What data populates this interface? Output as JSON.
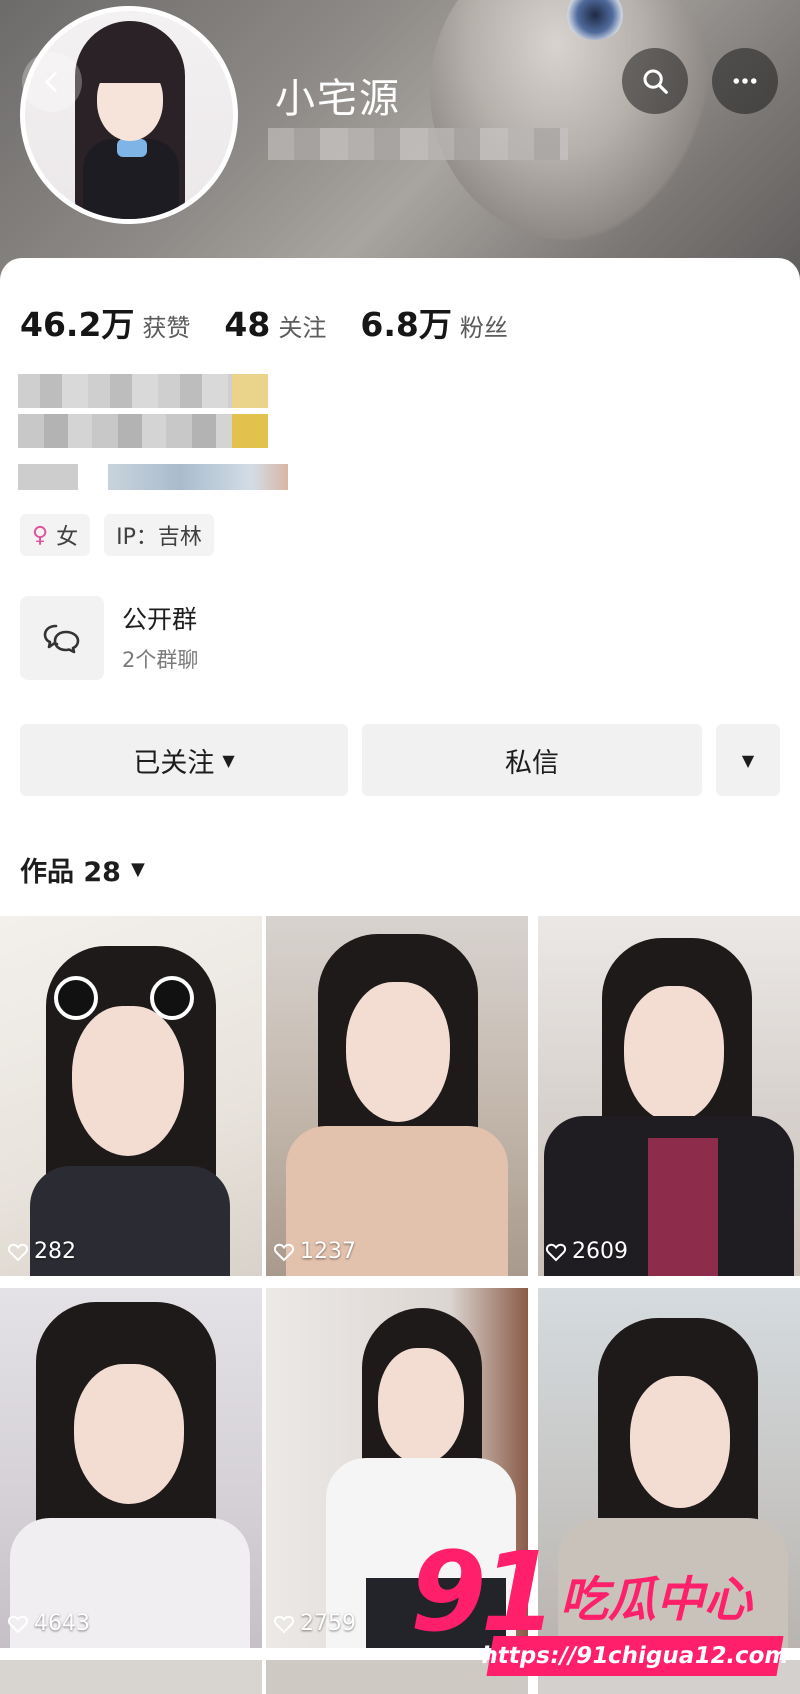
{
  "header": {
    "profile_name": "小宅源"
  },
  "stats": [
    {
      "value": "46.2万",
      "label": "获赞"
    },
    {
      "value": "48",
      "label": "关注"
    },
    {
      "value": "6.8万",
      "label": "粉丝"
    }
  ],
  "tags": {
    "gender": "女",
    "ip": "IP：吉林"
  },
  "group": {
    "title": "公开群",
    "subtitle": "2个群聊"
  },
  "buttons": {
    "follow": "已关注",
    "message": "私信"
  },
  "works": {
    "label": "作品 28"
  },
  "videos": [
    {
      "likes": "282"
    },
    {
      "likes": "1237"
    },
    {
      "likes": "2609"
    },
    {
      "likes": "4643"
    },
    {
      "likes": "2759"
    },
    {
      "likes": ""
    }
  ],
  "watermark": {
    "number": "91",
    "name": "吃瓜中心",
    "url": "https://91chigua12.com"
  },
  "colors": {
    "accent_pink": "#ff1f6a",
    "female_icon": "#e0529c"
  }
}
